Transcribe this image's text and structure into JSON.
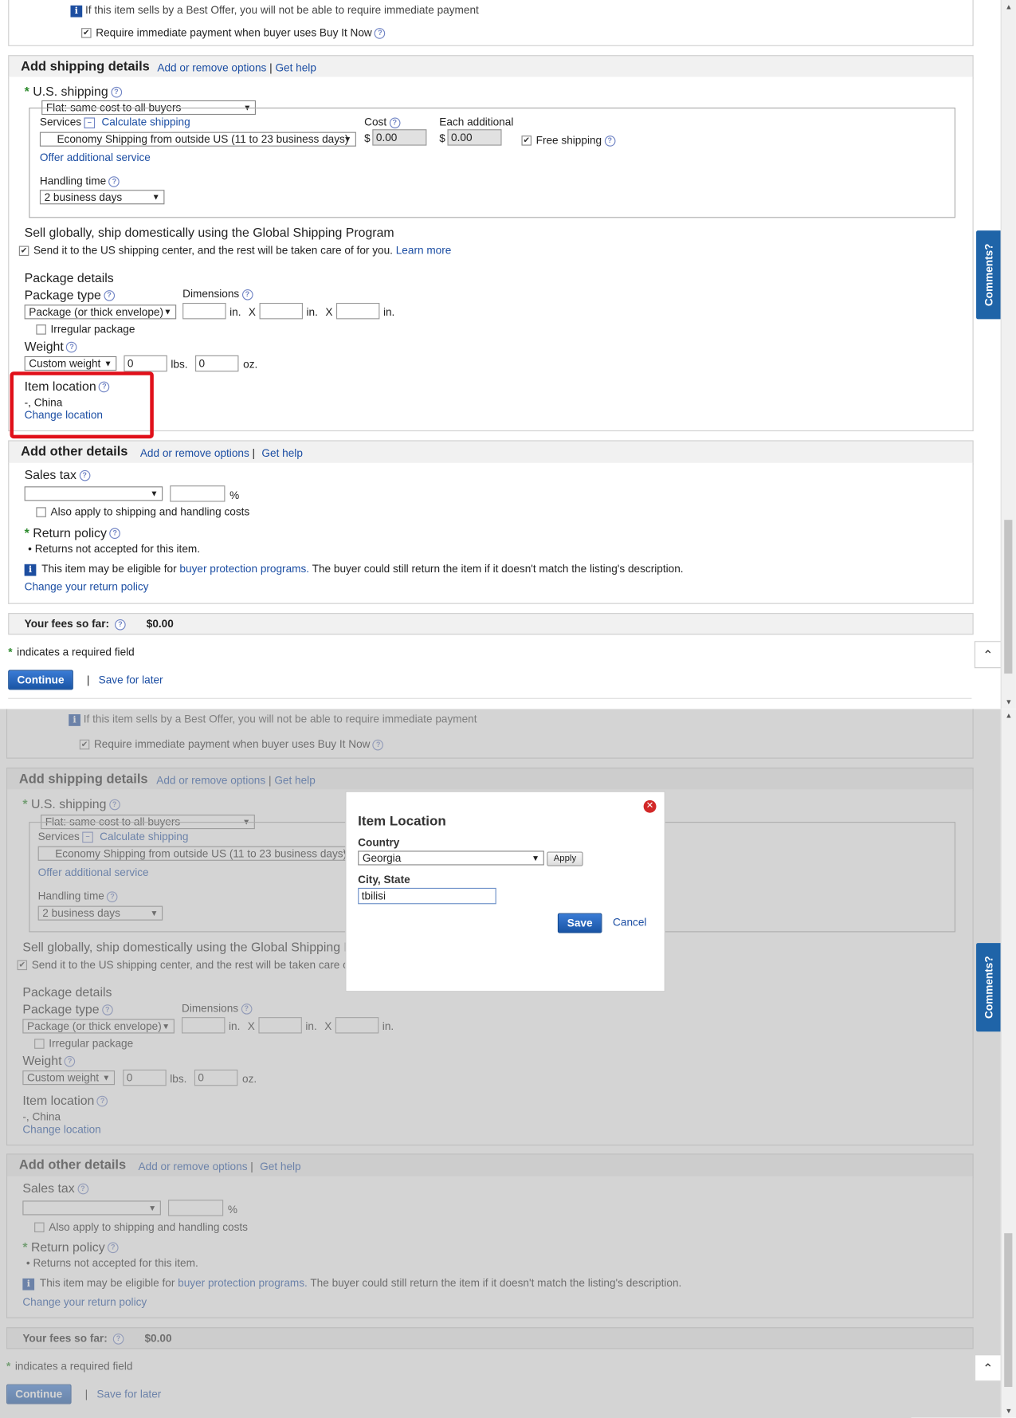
{
  "best_offer_note": "If this item sells by a Best Offer, you will not be able to require immediate payment",
  "require_payment_label": "Require immediate payment when buyer uses Buy It Now",
  "shipping": {
    "title": "Add shipping details",
    "add_remove": "Add or remove options",
    "separator": "|",
    "get_help": "Get help",
    "us_shipping_label": "U.S. shipping",
    "flat_option": "Flat: same cost to all buyers",
    "services_label": "Services",
    "calculate_link": "Calculate shipping",
    "cost_label": "Cost",
    "each_additional_label": "Each additional",
    "service_option": "Economy Shipping from outside US (11 to 23 business days)",
    "currency": "$",
    "cost_value": "0.00",
    "each_value": "0.00",
    "free_shipping": "Free shipping",
    "offer_additional": "Offer additional service",
    "handling_label": "Handling time",
    "handling_option": "2 business days",
    "global_title": "Sell globally, ship domestically using the Global Shipping Program",
    "global_text": "Send it to the US shipping center, and the rest will be taken care of for you.",
    "learn_more": "Learn more",
    "package_details": "Package details",
    "package_type_label": "Package type",
    "package_type_option": "Package (or thick envelope)",
    "dimensions_label": "Dimensions",
    "unit_in": "in.",
    "times": "X",
    "irregular": "Irregular package",
    "weight_label": "Weight",
    "weight_option": "Custom weight",
    "lbs_value": "0",
    "lbs_unit": "lbs.",
    "oz_value": "0",
    "oz_unit": "oz.",
    "item_location_label": "Item location",
    "item_location_value": "-, China",
    "change_location": "Change location"
  },
  "other": {
    "title": "Add other details",
    "add_remove": "Add or remove options",
    "separator": "|",
    "get_help": "Get help",
    "sales_tax_label": "Sales tax",
    "percent": "%",
    "also_apply": "Also apply to shipping and handling costs",
    "return_policy_label": "Return policy",
    "returns_not_accepted": "Returns not accepted for this item.",
    "eligible_pre": "This item may be eligible for",
    "buyer_protection": "buyer protection programs.",
    "eligible_post": "The buyer could still return the item if it doesn't match the listing's description.",
    "change_return": "Change your return policy"
  },
  "fees": {
    "label": "Your fees so far:",
    "value": "$0.00"
  },
  "required_asterisk": "*",
  "required_note": "indicates a required field",
  "continue_label": "Continue",
  "pipe": "|",
  "save_later": "Save for later",
  "comments_tab": "Comments?",
  "dialog": {
    "title": "Item Location",
    "country_label": "Country",
    "country_value": "Georgia",
    "apply": "Apply",
    "city_label": "City, State",
    "city_value": "tbilisi",
    "save": "Save",
    "cancel": "Cancel"
  },
  "icons": {
    "help": "?",
    "info": "i",
    "check": "✔",
    "close": "✕",
    "caret": "▼",
    "up_chevron": "⌃"
  },
  "colors": {
    "link": "#1c4ea3",
    "primary_button": "#1a55a5",
    "highlight": "#e0101a",
    "required": "#2e8b2e"
  }
}
